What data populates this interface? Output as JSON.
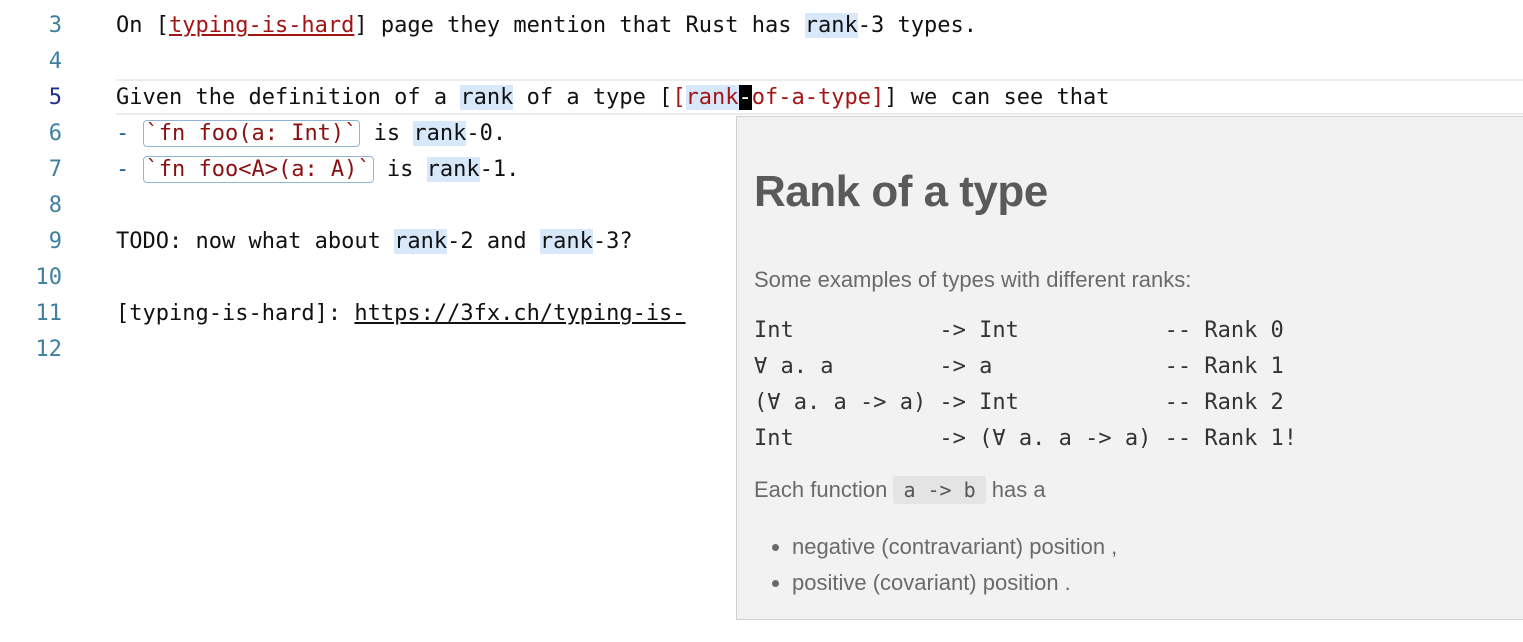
{
  "gutter": {
    "line_numbers": [
      "3",
      "4",
      "5",
      "6",
      "7",
      "8",
      "9",
      "10",
      "11",
      "12"
    ]
  },
  "editor": {
    "l3": {
      "pre": "On [",
      "ref": "typing-is-hard",
      "mid": "] page they mention that Rust has ",
      "hl": "rank",
      "post": "-3 types."
    },
    "l5": {
      "pre": "Given the definition of a ",
      "hl1": "rank",
      "mid": " of a type [",
      "bracket": "[",
      "hl2": "rank",
      "caret": "-",
      "ref_rest": "of-a-type",
      "close": "]",
      "post": "] we can see that"
    },
    "l6": {
      "dash": "- ",
      "code": "`fn foo(a: Int)`",
      "mid": " is ",
      "hl": "rank",
      "post": "-0."
    },
    "l7": {
      "dash": "- ",
      "code": "`fn foo<A>(a: A)`",
      "mid": " is ",
      "hl": "rank",
      "post": "-1."
    },
    "l9": {
      "pre": "TODO: now what about ",
      "hl1": "rank",
      "mid": "-2 and ",
      "hl2": "rank",
      "post": "-3?"
    },
    "l11": {
      "pre": "[typing-is-hard]: ",
      "link": "https://3fx.ch/typing-is-"
    }
  },
  "popup": {
    "title": "Rank of a type",
    "intro": "Some examples of types with different ranks:",
    "code": "Int           -> Int           -- Rank 0\n∀ a. a        -> a             -- Rank 1\n(∀ a. a -> a) -> Int           -- Rank 2\nInt           -> (∀ a. a -> a) -- Rank 1!",
    "each_pre": "Each function ",
    "each_code": "a -> b",
    "each_post": " has a",
    "bullets": [
      "negative (contravariant) position ,",
      "positive (covariant) position ."
    ]
  }
}
